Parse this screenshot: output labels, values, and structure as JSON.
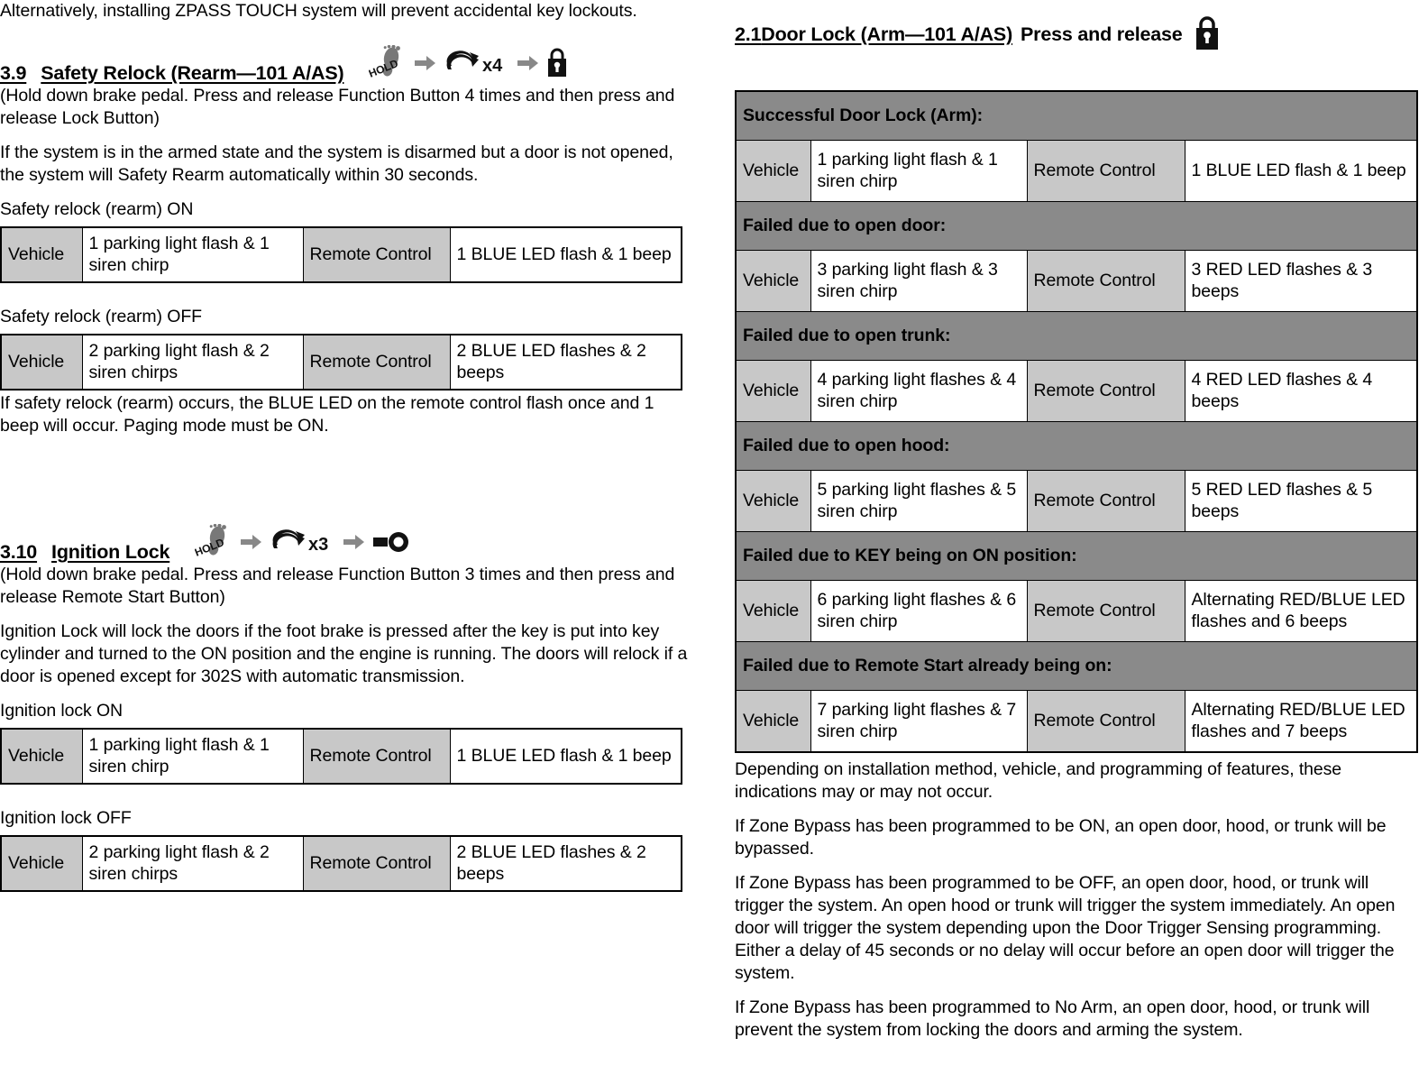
{
  "left": {
    "intro_paragraph": "Alternatively, installing ZPASS TOUCH system will prevent accidental key lockouts.",
    "section_39": {
      "number": "3.9",
      "title": "Safety Relock (Rearm—101 A/AS)",
      "icons": [
        "foot-hold-icon",
        "arrow-right-icon",
        "refresh-x4-icon",
        "arrow-right-icon",
        "padlock-icon"
      ],
      "icon_multiplier": "x4",
      "icon_hold_label": "HOLD",
      "instruction": "(Hold down brake pedal.  Press and release Function Button 4 times and then press and release Lock Button)",
      "description": "If the system is in the armed state and the system is disarmed but a door is not opened, the system will Safety Rearm automatically within 30 seconds.",
      "table_on_caption": "Safety relock (rearm) ON",
      "table_on": {
        "vehicle_label": "Vehicle",
        "vehicle_value": "1 parking light flash & 1 siren chirp",
        "remote_label": "Remote Control",
        "remote_value": "1 BLUE LED flash & 1 beep"
      },
      "table_off_caption": "Safety relock (rearm) OFF",
      "table_off": {
        "vehicle_label": "Vehicle",
        "vehicle_value": "2 parking light flash & 2 siren chirps",
        "remote_label": "Remote Control",
        "remote_value": "2 BLUE LED flashes & 2 beeps"
      },
      "footnote": "If safety relock (rearm) occurs, the BLUE LED on the remote control flash once and 1 beep will occur.  Paging mode must be ON."
    },
    "section_310": {
      "number": "3.10",
      "title": "Ignition Lock",
      "icons": [
        "foot-hold-icon",
        "arrow-right-icon",
        "refresh-x3-icon",
        "arrow-right-icon",
        "key-icon"
      ],
      "icon_multiplier": "x3",
      "icon_hold_label": "HOLD",
      "instruction": "(Hold down brake pedal.  Press and release Function Button 3 times and then press and release Remote Start Button)",
      "description": "Ignition Lock will lock the doors if the foot brake is pressed after the key is put into key cylinder and turned to the ON position and the engine is running.  The doors will relock if a door is opened except for 302S with automatic transmission.",
      "table_on_caption": "Ignition lock ON",
      "table_on": {
        "vehicle_label": "Vehicle",
        "vehicle_value": "1 parking light flash & 1 siren chirp",
        "remote_label": "Remote Control",
        "remote_value": "1 BLUE LED flash & 1 beep"
      },
      "table_off_caption": "Ignition lock OFF",
      "table_off": {
        "vehicle_label": "Vehicle",
        "vehicle_value": "2 parking light flash & 2 siren chirps",
        "remote_label": "Remote Control",
        "remote_value": "2 BLUE LED flashes & 2 beeps"
      }
    }
  },
  "right": {
    "section_21": {
      "number": "2.1",
      "title": "Door Lock (Arm—101 A/AS)",
      "suffix": "Press and release",
      "icon": "padlock-icon"
    },
    "table": {
      "vehicle_label": "Vehicle",
      "remote_label": "Remote Control",
      "groups": [
        {
          "header": "Successful Door Lock (Arm):",
          "vehicle_value": "1 parking light flash & 1 siren chirp",
          "remote_value": "1 BLUE LED flash & 1 beep"
        },
        {
          "header": "Failed due to open door:",
          "vehicle_value": "3 parking light flash & 3 siren chirp",
          "remote_value": "3 RED LED flashes & 3 beeps"
        },
        {
          "header": "Failed due to open trunk:",
          "vehicle_value": "4 parking light flashes & 4 siren chirp",
          "remote_value": "4 RED LED flashes & 4 beeps"
        },
        {
          "header": "Failed due to open hood:",
          "vehicle_value": "5 parking light flashes & 5 siren chirp",
          "remote_value": "5 RED LED flashes & 5 beeps"
        },
        {
          "header": "Failed due to KEY being on ON position:",
          "vehicle_value": "6 parking light flashes & 6 siren chirp",
          "remote_value": "Alternating RED/BLUE LED flashes and 6 beeps"
        },
        {
          "header": "Failed due to Remote Start already being on:",
          "vehicle_value": "7 parking light flashes & 7 siren chirp",
          "remote_value": "Alternating RED/BLUE LED flashes and 7 beeps"
        }
      ]
    },
    "notes": [
      "Depending on installation method, vehicle, and programming of features, these indications may or may not occur.",
      "If Zone Bypass has been programmed to be ON, an open door, hood, or trunk will be bypassed.",
      "If Zone Bypass has been programmed to be OFF, an open door, hood, or trunk will trigger the system.  An open hood or trunk will trigger the system immediately.  An open door will trigger the system depending upon the Door Trigger Sensing programming.  Either a delay of 45 seconds or no delay will occur before an open door will trigger the system.",
      "If Zone Bypass has been programmed to No Arm, an open door, hood, or trunk will prevent the system from locking the doors and arming the system."
    ]
  },
  "colors": {
    "header_gray": "#8a8a8a",
    "label_gray": "#c8c8c8",
    "arrow_gray": "#808080",
    "text_black": "#000000"
  }
}
